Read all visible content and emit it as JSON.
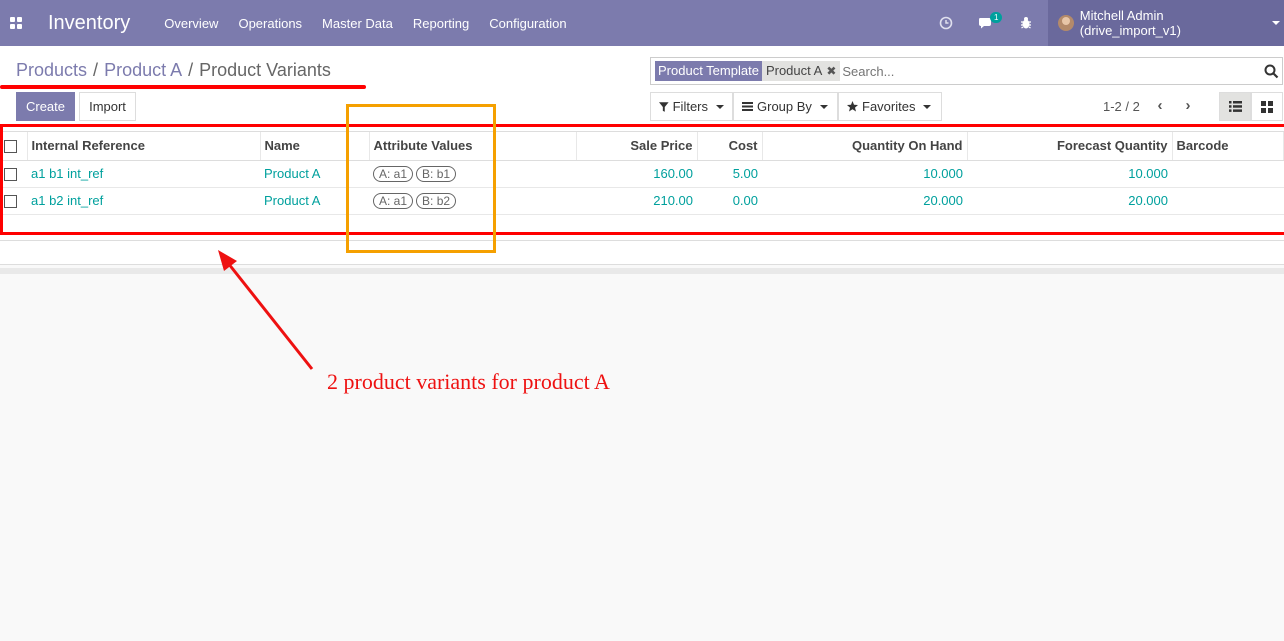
{
  "navbar": {
    "brand": "Inventory",
    "menu": [
      "Overview",
      "Operations",
      "Master Data",
      "Reporting",
      "Configuration"
    ],
    "messages_badge": "1",
    "user": "Mitchell Admin (drive_import_v1)"
  },
  "breadcrumb": {
    "items": [
      "Products",
      "Product A"
    ],
    "current": "Product Variants"
  },
  "search": {
    "facet_label": "Product Template",
    "facet_value": "Product A",
    "facet_remove": "✖",
    "placeholder": "Search..."
  },
  "buttons": {
    "create": "Create",
    "import": "Import"
  },
  "filters": {
    "filters": "Filters",
    "group_by": "Group By",
    "favorites": "Favorites"
  },
  "pager": {
    "value": "1-2 / 2"
  },
  "table": {
    "headers": {
      "internal_reference": "Internal Reference",
      "name": "Name",
      "attribute_values": "Attribute Values",
      "sale_price": "Sale Price",
      "cost": "Cost",
      "qty_on_hand": "Quantity On Hand",
      "forecast_qty": "Forecast Quantity",
      "barcode": "Barcode"
    },
    "rows": [
      {
        "internal_reference": "a1 b1 int_ref",
        "name": "Product A",
        "attribute_values": [
          "A: a1",
          "B: b1"
        ],
        "sale_price": "160.00",
        "cost": "5.00",
        "qty_on_hand": "10.000",
        "forecast_qty": "10.000",
        "barcode": ""
      },
      {
        "internal_reference": "a1 b2 int_ref",
        "name": "Product A",
        "attribute_values": [
          "A: a1",
          "B: b2"
        ],
        "sale_price": "210.00",
        "cost": "0.00",
        "qty_on_hand": "20.000",
        "forecast_qty": "20.000",
        "barcode": ""
      }
    ]
  },
  "annotation": {
    "text": "2 product variants for product A",
    "colors": {
      "red": "#ff0000",
      "orange": "#f5a000"
    }
  },
  "colors": {
    "brand": "#7c7bad",
    "link": "#00a09d"
  }
}
